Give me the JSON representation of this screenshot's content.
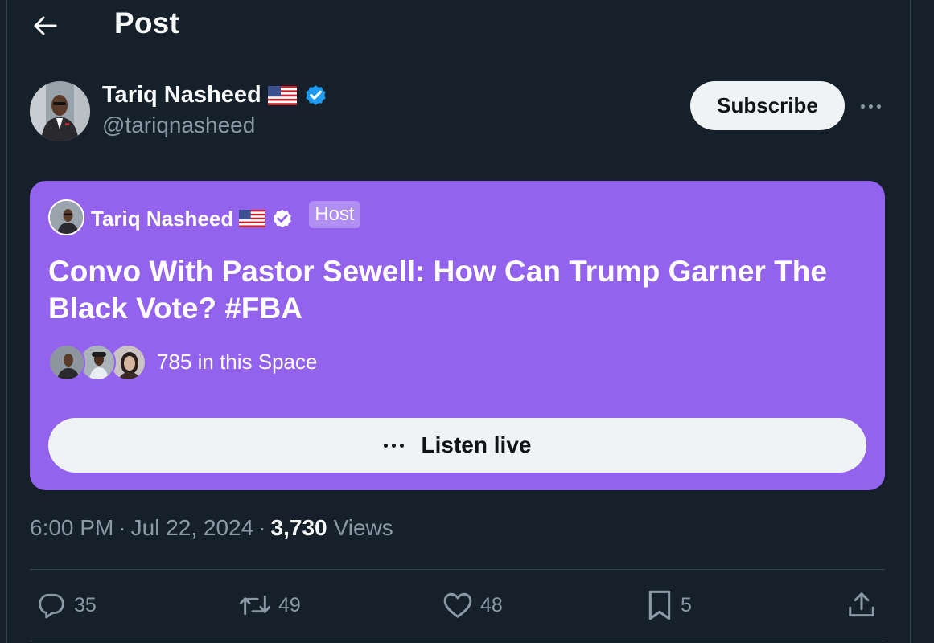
{
  "header": {
    "back_icon": "arrow-left-icon",
    "title": "Post"
  },
  "author": {
    "name": "Tariq Nasheed",
    "flag_icon": "us-flag-icon",
    "verified_icon": "verified-badge-icon",
    "handle": "@tariqnasheed",
    "subscribe_label": "Subscribe",
    "more_icon": "more-horizontal-icon"
  },
  "space": {
    "background_color": "#9463ee",
    "host_name": "Tariq Nasheed",
    "host_badge": "Host",
    "title": "Convo With Pastor Sewell: How Can Trump Garner The Black Vote? #FBA",
    "listener_count_text": "785 in this Space",
    "listen_label": "Listen live"
  },
  "meta": {
    "time": "6:00 PM",
    "separator": "·",
    "date": "Jul 22, 2024",
    "views_count": "3,730",
    "views_label": "Views"
  },
  "actions": {
    "replies": "35",
    "reposts": "49",
    "likes": "48",
    "bookmarks": "5"
  },
  "colors": {
    "background": "#15202b",
    "secondary_text": "#8b98a5",
    "verified_blue": "#1d9bf0"
  }
}
